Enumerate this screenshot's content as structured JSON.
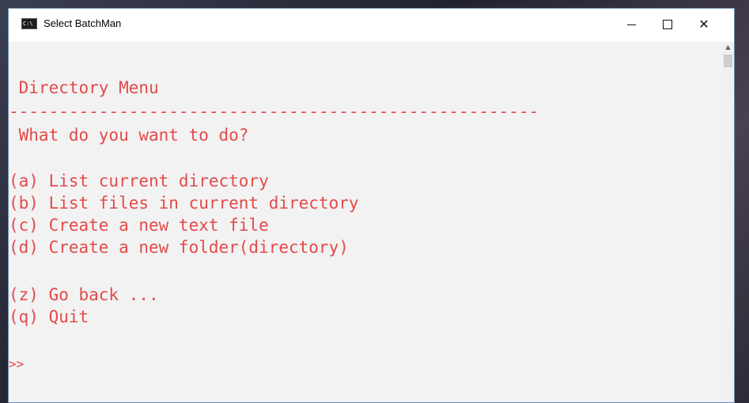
{
  "window": {
    "title": "Select BatchMan",
    "icon_label": "C:\\",
    "controls": {
      "minimize_icon": "minimize-icon",
      "maximize_icon": "maximize-icon",
      "close_icon": "close-icon",
      "close_glyph": "✕"
    }
  },
  "console": {
    "text_color": "#e34a4a",
    "background": "#f2f2f2",
    "heading": " Directory Menu",
    "separator": "-----------------------------------------------------",
    "prompt_question": " What do you want to do?",
    "options": [
      "(a) List current directory",
      "(b) List files in current directory",
      "(c) Create a new text file",
      "(d) Create a new folder(directory)"
    ],
    "nav_options": [
      "(z) Go back ...",
      "(q) Quit"
    ],
    "input_prompt": ">>"
  },
  "scrollbar": {
    "up_arrow_glyph": "▲"
  }
}
